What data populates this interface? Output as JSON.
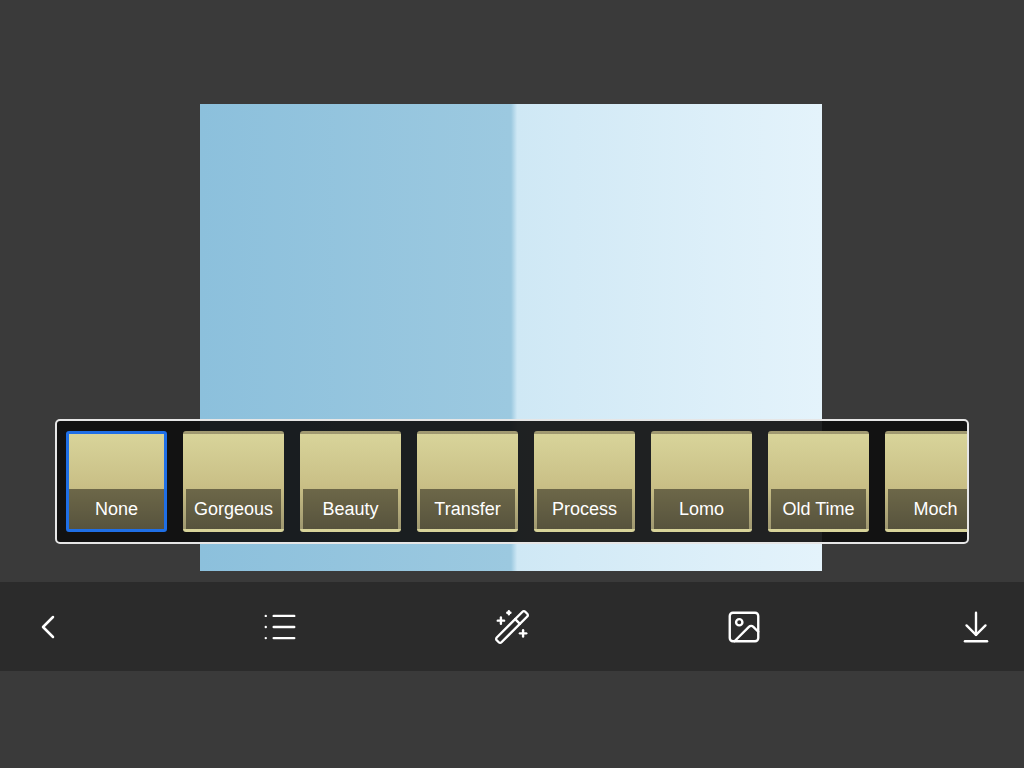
{
  "filters": [
    {
      "label": "None",
      "selected": true
    },
    {
      "label": "Gorgeous",
      "selected": false
    },
    {
      "label": "Beauty",
      "selected": false
    },
    {
      "label": "Transfer",
      "selected": false
    },
    {
      "label": "Process",
      "selected": false
    },
    {
      "label": "Lomo",
      "selected": false
    },
    {
      "label": "Old Time",
      "selected": false
    },
    {
      "label": "Moch",
      "selected": false
    }
  ]
}
